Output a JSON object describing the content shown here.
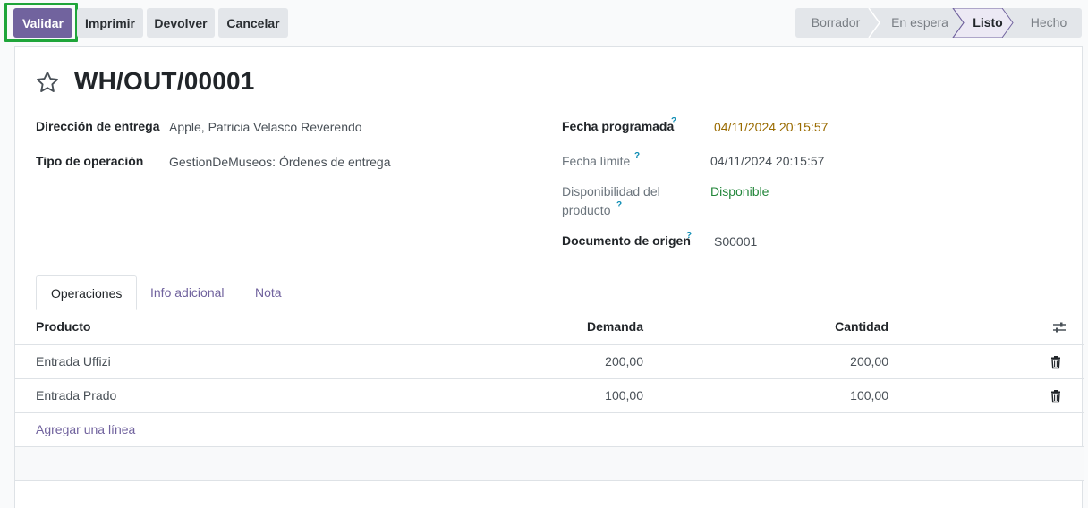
{
  "toolbar": {
    "validate": "Validar",
    "print": "Imprimir",
    "return": "Devolver",
    "cancel": "Cancelar"
  },
  "status": {
    "stages": [
      "Borrador",
      "En espera",
      "Listo",
      "Hecho"
    ],
    "active": "Listo"
  },
  "record": {
    "title": "WH/OUT/00001",
    "fields_left": [
      {
        "label": "Dirección de entrega",
        "value": "Apple, Patricia Velasco Reverendo"
      },
      {
        "label": "Tipo de operación",
        "value": "GestionDeMuseos: Órdenes de entrega"
      }
    ],
    "fields_right": [
      {
        "label": "Fecha programada",
        "help": "?",
        "value": "04/11/2024 20:15:57"
      },
      {
        "label": "Fecha límite",
        "help": "?",
        "value": "04/11/2024 20:15:57"
      },
      {
        "label_line1": "Disponibilidad del",
        "label_line2": "producto",
        "help": "?",
        "value": "Disponible"
      },
      {
        "label": "Documento de origen",
        "help": "?",
        "value": "S00001"
      }
    ]
  },
  "tabs": [
    "Operaciones",
    "Info adicional",
    "Nota"
  ],
  "table": {
    "columns": [
      "Producto",
      "Demanda",
      "Cantidad"
    ],
    "rows": [
      {
        "product": "Entrada Uffizi",
        "demand": "200,00",
        "quantity": "200,00"
      },
      {
        "product": "Entrada Prado",
        "demand": "100,00",
        "quantity": "100,00"
      }
    ],
    "add_line": "Agregar una línea"
  },
  "icons": {
    "favorite": "star-icon",
    "column_settings": "sliders-icon",
    "delete": "trash-icon"
  },
  "colors": {
    "primary": "#71639e",
    "highlight": "#1fa53a",
    "warning_date": "#9a6b00",
    "available": "#22863a"
  }
}
